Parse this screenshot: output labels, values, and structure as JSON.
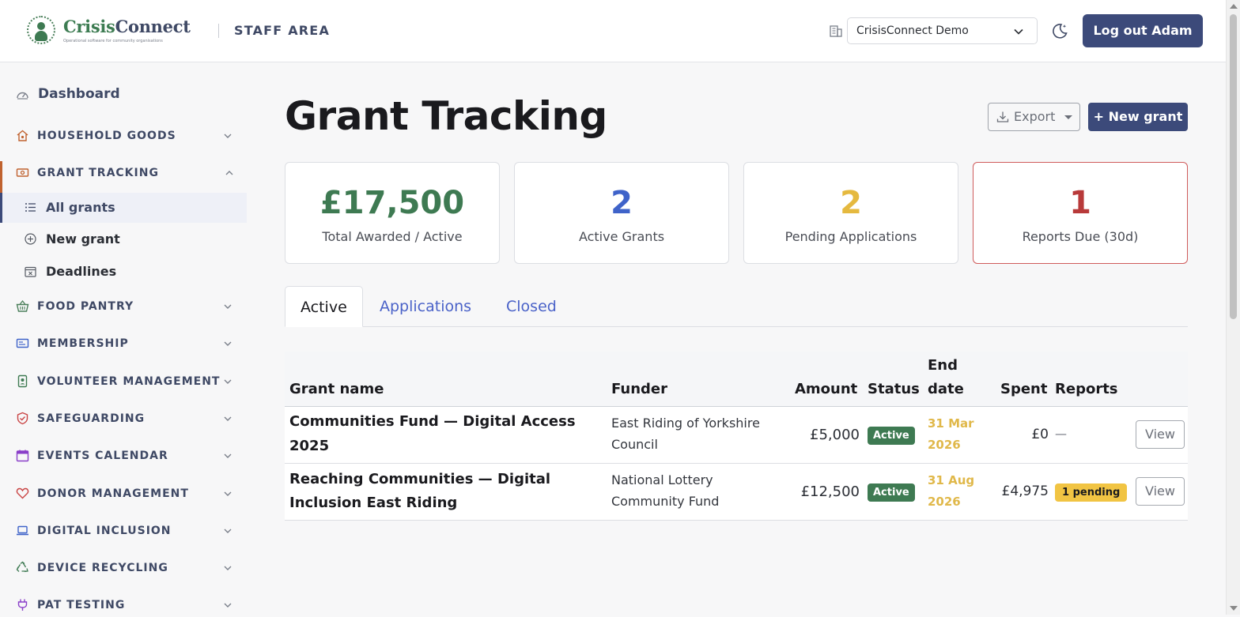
{
  "header": {
    "logo_name_part1": "Crisis",
    "logo_name_part2": "Connect",
    "logo_tagline": "Operational software for community organisations",
    "area_label": "STAFF AREA",
    "org_selected": "CrisisConnect Demo",
    "logout_label": "Log out Adam"
  },
  "sidebar": {
    "dashboard_label": "Dashboard",
    "sections": [
      {
        "label": "HOUSEHOLD GOODS",
        "icon": "house-icon"
      },
      {
        "label": "GRANT TRACKING",
        "icon": "money-icon"
      },
      {
        "label": "FOOD PANTRY",
        "icon": "basket-icon"
      },
      {
        "label": "MEMBERSHIP",
        "icon": "id-card-icon"
      },
      {
        "label": "VOLUNTEER MANAGEMENT",
        "icon": "badge-icon"
      },
      {
        "label": "SAFEGUARDING",
        "icon": "shield-icon"
      },
      {
        "label": "EVENTS CALENDAR",
        "icon": "calendar-icon"
      },
      {
        "label": "DONOR MANAGEMENT",
        "icon": "heart-icon"
      },
      {
        "label": "DIGITAL INCLUSION",
        "icon": "laptop-icon"
      },
      {
        "label": "DEVICE RECYCLING",
        "icon": "recycle-icon"
      },
      {
        "label": "PAT TESTING",
        "icon": "plug-icon"
      }
    ],
    "grant_items": [
      {
        "label": "All grants",
        "icon": "list-icon"
      },
      {
        "label": "New grant",
        "icon": "plus-circle-icon"
      },
      {
        "label": "Deadlines",
        "icon": "calendar-x-icon"
      }
    ]
  },
  "page": {
    "title": "Grant Tracking",
    "export_label": "Export",
    "new_grant_label": "+ New grant"
  },
  "stats": [
    {
      "value": "£17,500",
      "caption": "Total Awarded / Active",
      "color": "#3e7a52"
    },
    {
      "value": "2",
      "caption": "Active Grants",
      "color": "#3f63c9"
    },
    {
      "value": "2",
      "caption": "Pending Applications",
      "color": "#e5b93f"
    },
    {
      "value": "1",
      "caption": "Reports Due (30d)",
      "color": "#b83a3a"
    }
  ],
  "tabs": [
    "Active",
    "Applications",
    "Closed"
  ],
  "table": {
    "headers": {
      "name": "Grant name",
      "funder": "Funder",
      "amount": "Amount",
      "status": "Status",
      "end_line1": "End",
      "end_line2": "date",
      "spent": "Spent",
      "reports": "Reports"
    },
    "rows": [
      {
        "name_line1": "Communities Fund — Digital Access",
        "name_line2": "2025",
        "funder_line1": "East Riding of Yorkshire",
        "funder_line2": "Council",
        "amount": "£5,000",
        "status": "Active",
        "end_line1": "31 Mar",
        "end_line2": "2026",
        "spent": "£0",
        "reports": "—",
        "action": "View"
      },
      {
        "name_line1": "Reaching Communities — Digital",
        "name_line2": "Inclusion East Riding",
        "funder_line1": "National Lottery",
        "funder_line2": "Community Fund",
        "amount": "£12,500",
        "status": "Active",
        "end_line1": "31 Aug",
        "end_line2": "2026",
        "spent": "£4,975",
        "reports": "1 pending",
        "action": "View"
      }
    ]
  }
}
